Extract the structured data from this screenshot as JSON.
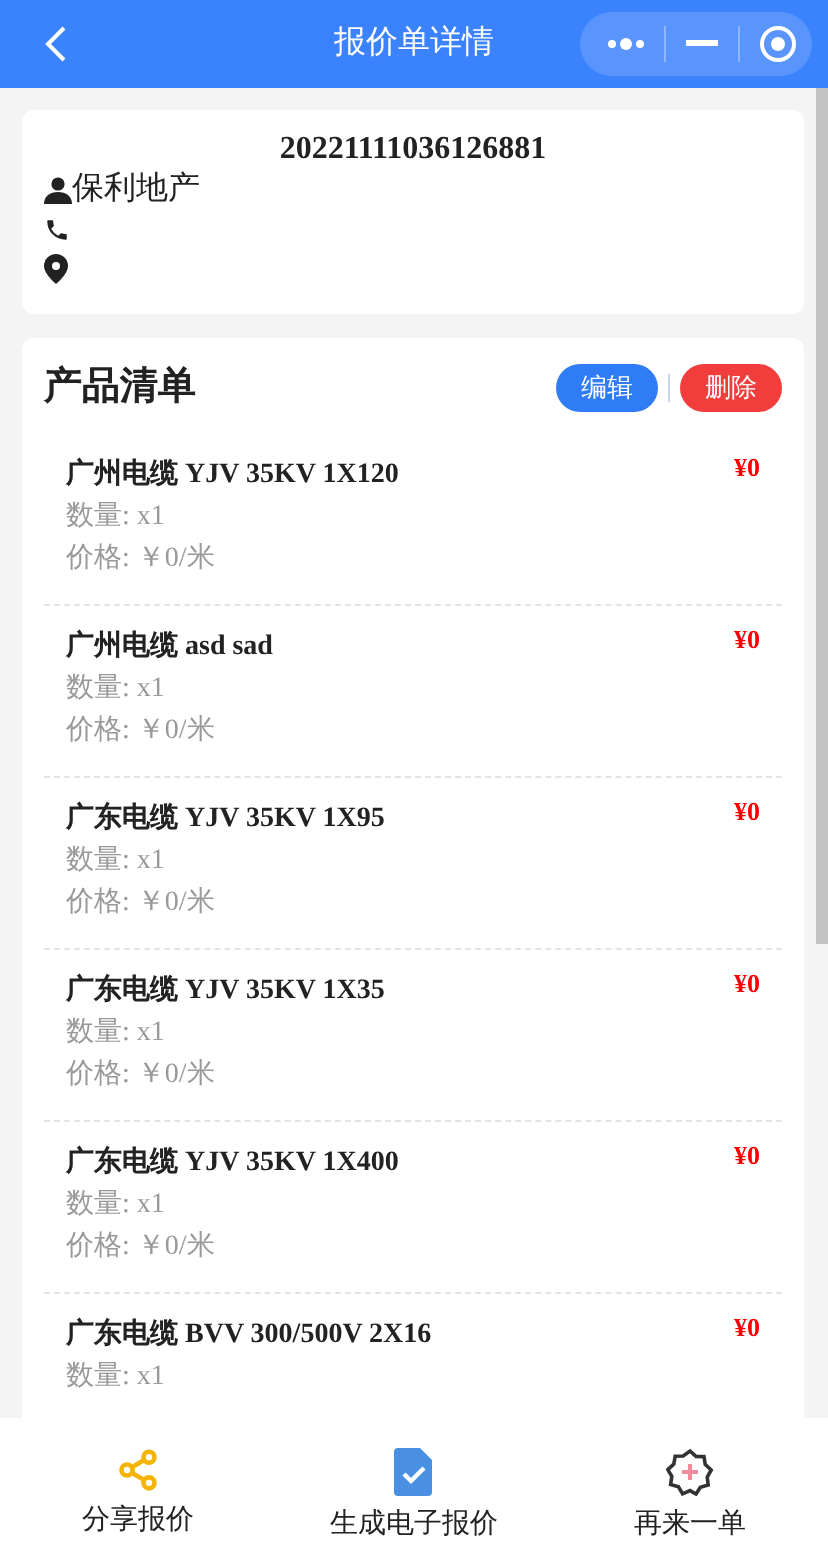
{
  "header": {
    "title": "报价单详情"
  },
  "order": {
    "number": "20221111036126881",
    "customer": "保利地产"
  },
  "products": {
    "title": "产品清单",
    "actions": [
      {
        "label": "编辑",
        "kind": "edit"
      },
      {
        "label": "删除",
        "kind": "delete"
      }
    ],
    "items": [
      {
        "name": "广州电缆 YJV 35KV 1X120",
        "total": "¥0",
        "quantity": "数量: x1",
        "price": "价格: ￥0/米"
      },
      {
        "name": "广州电缆 asd sad",
        "total": "¥0",
        "quantity": "数量: x1",
        "price": "价格: ￥0/米"
      },
      {
        "name": "广东电缆 YJV 35KV 1X95",
        "total": "¥0",
        "quantity": "数量: x1",
        "price": "价格: ￥0/米"
      },
      {
        "name": "广东电缆 YJV 35KV 1X35",
        "total": "¥0",
        "quantity": "数量: x1",
        "price": "价格: ￥0/米"
      },
      {
        "name": "广东电缆 YJV 35KV 1X400",
        "total": "¥0",
        "quantity": "数量: x1",
        "price": "价格: ￥0/米"
      },
      {
        "name": "广东电缆 BVV 300/500V 2X16",
        "total": "¥0",
        "quantity": "数量: x1"
      }
    ]
  },
  "footer": [
    {
      "label": "分享报价",
      "kind": "share"
    },
    {
      "label": "生成电子报价",
      "kind": "generate"
    },
    {
      "label": "再来一单",
      "kind": "reorder"
    }
  ]
}
